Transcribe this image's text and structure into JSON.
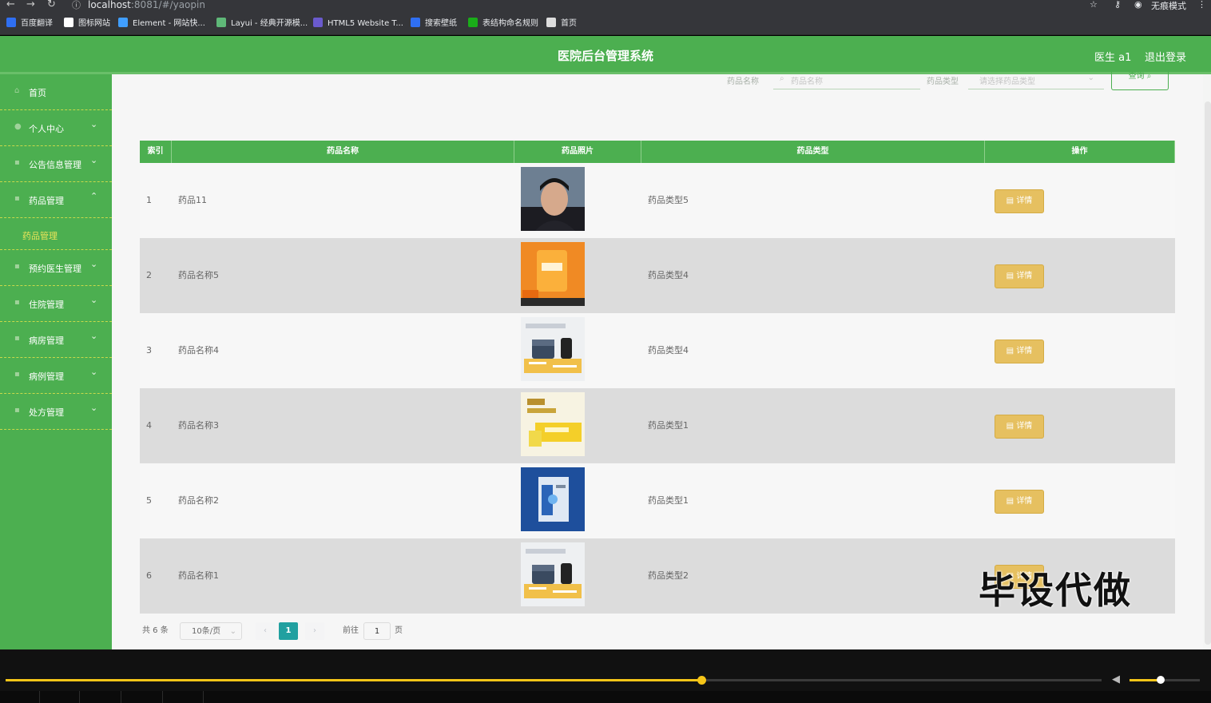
{
  "browser": {
    "url_host": "localhost",
    "url_rest": ":8081/#/yaopin",
    "incognito_label": "无痕模式",
    "bookmarks": [
      {
        "label": "百度翻译",
        "color": "#2f6ff2"
      },
      {
        "label": "图标网站",
        "color": "#ffffff"
      },
      {
        "label": "Element - 网站快...",
        "color": "#409eff"
      },
      {
        "label": "Layui - 经典开源模...",
        "color": "#5fb878"
      },
      {
        "label": "HTML5 Website T...",
        "color": "#6a5acd"
      },
      {
        "label": "搜索壁纸",
        "color": "#2f6ff2"
      },
      {
        "label": "表结构命名规则",
        "color": "#1aad19"
      },
      {
        "label": "首页",
        "color": "#dddddd"
      }
    ]
  },
  "header": {
    "title": "医院后台管理系统",
    "user": "医生 a1",
    "logout": "退出登录"
  },
  "sidebar": {
    "items": [
      {
        "label": "首页",
        "icon": "home-icon",
        "has_arrow": false
      },
      {
        "label": "个人中心",
        "icon": "user-icon",
        "has_arrow": true
      },
      {
        "label": "公告信息管理",
        "icon": "menu-icon",
        "has_arrow": true
      },
      {
        "label": "药品管理",
        "icon": "menu-icon",
        "has_arrow": true,
        "expanded": true
      },
      {
        "label": "预约医生管理",
        "icon": "menu-icon",
        "has_arrow": true
      },
      {
        "label": "住院管理",
        "icon": "menu-icon",
        "has_arrow": true
      },
      {
        "label": "病房管理",
        "icon": "menu-icon",
        "has_arrow": true
      },
      {
        "label": "病例管理",
        "icon": "menu-icon",
        "has_arrow": true
      },
      {
        "label": "处方管理",
        "icon": "menu-icon",
        "has_arrow": true
      }
    ],
    "sub_item": "药品管理"
  },
  "search": {
    "name_label": "药品名称",
    "name_placeholder": "药品名称",
    "type_label": "药品类型",
    "type_placeholder": "请选择药品类型",
    "query_button": "查询"
  },
  "table": {
    "columns": [
      "索引",
      "药品名称",
      "药品照片",
      "药品类型",
      "操作"
    ],
    "rows": [
      {
        "index": "1",
        "name": "药品11",
        "type": "药品类型5",
        "action": "详情",
        "photo": "portrait"
      },
      {
        "index": "2",
        "name": "药品名称5",
        "type": "药品类型4",
        "action": "详情",
        "photo": "orange-box"
      },
      {
        "index": "3",
        "name": "药品名称4",
        "type": "药品类型4",
        "action": "详情",
        "photo": "supplement-bottles"
      },
      {
        "index": "4",
        "name": "药品名称3",
        "type": "药品类型1",
        "action": "详情",
        "photo": "yellow-box"
      },
      {
        "index": "5",
        "name": "药品名称2",
        "type": "药品类型1",
        "action": "详情",
        "photo": "blue-box"
      },
      {
        "index": "6",
        "name": "药品名称1",
        "type": "药品类型2",
        "action": "详情",
        "photo": "supplement-bottles"
      }
    ]
  },
  "pagination": {
    "total": "共 6 条",
    "page_size": "10条/页",
    "current_page": "1",
    "goto_prefix": "前往",
    "goto_value": "1",
    "goto_suffix": "页"
  },
  "watermark": "毕设代做",
  "player": {
    "progress": 0.635,
    "volume": 0.44
  },
  "colors": {
    "accent": "#4caf50",
    "detail_button": "#e6c060",
    "page_active": "#21a0a0"
  }
}
